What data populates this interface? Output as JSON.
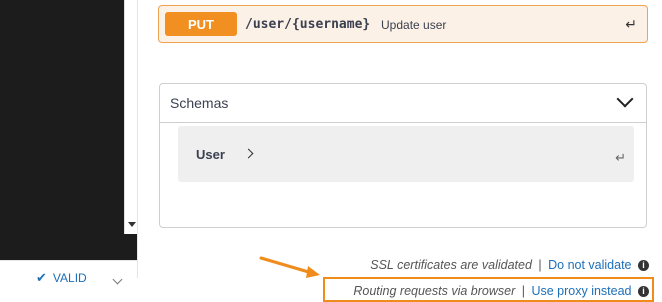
{
  "operation": {
    "method": "PUT",
    "path": "/user/{username}",
    "summary": "Update user",
    "method_color": "#f28f21",
    "bg_color": "#fcf1e6",
    "border_color": "#f0a253"
  },
  "schemas": {
    "title": "Schemas",
    "models": [
      {
        "name": "User"
      }
    ]
  },
  "status": {
    "valid_label": "VALID"
  },
  "ssl": {
    "text": "SSL certificates are validated",
    "separator": "|",
    "link": "Do not validate"
  },
  "routing": {
    "text": "Routing requests via browser",
    "separator": "|",
    "link": "Use proxy instead"
  },
  "icons": {
    "info": "i",
    "return": "↵",
    "check": "✔"
  },
  "colors": {
    "highlight": "#f08c1c",
    "link": "#1d6fb8"
  }
}
